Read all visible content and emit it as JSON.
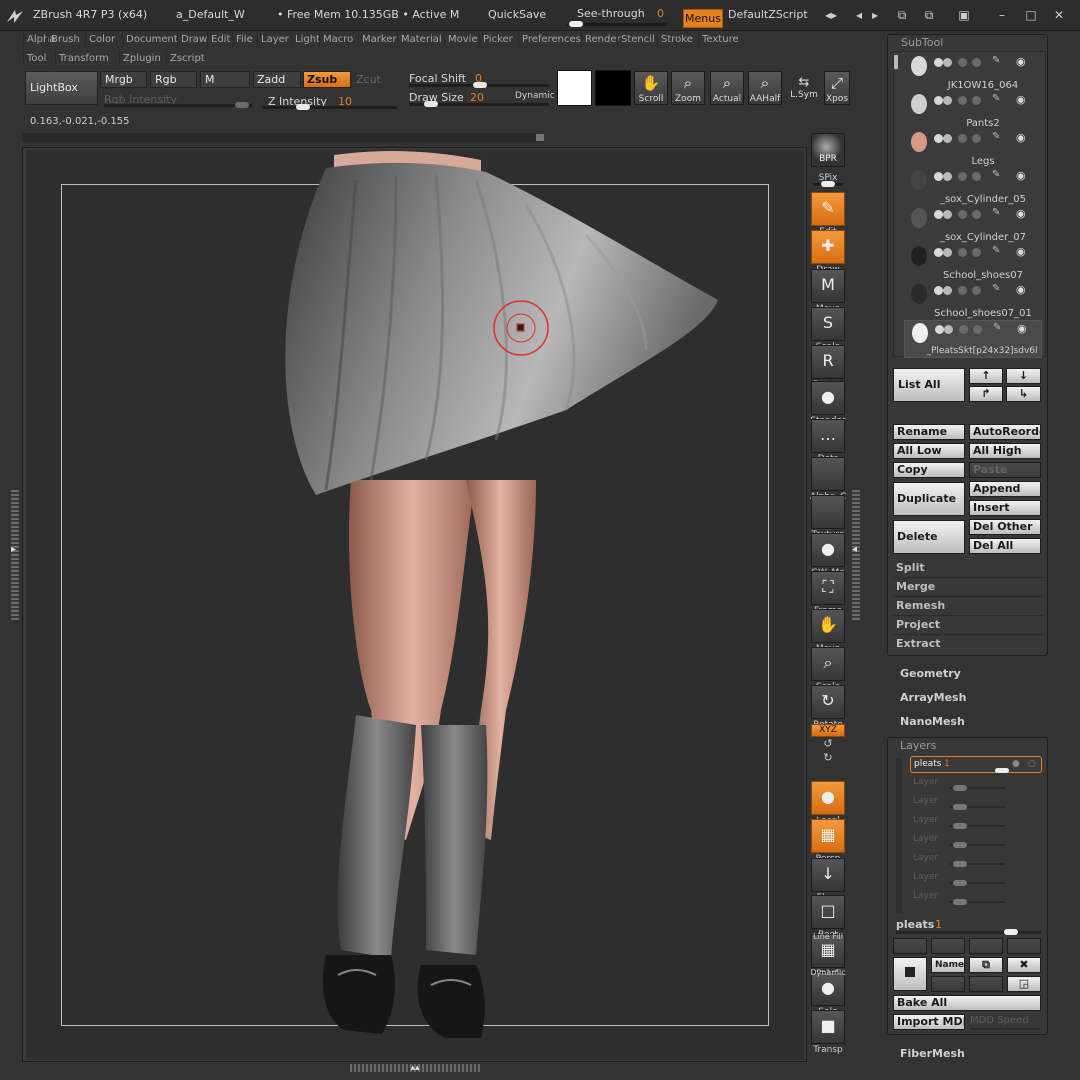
{
  "titlebar": {
    "app_title": "ZBrush 4R7 P3 (x64)",
    "doc_name": "a_Default_W",
    "free_mem": "• Free Mem 10.135GB • Active M",
    "quicksave": "QuickSave",
    "see_through": "See-through",
    "see_through_value": "0",
    "menus": "Menus",
    "default_zscript": "DefaultZScript"
  },
  "menu_row1": [
    "Alpha",
    "Brush",
    "Color",
    "Document",
    "Draw",
    "Edit",
    "File",
    "Layer",
    "Light",
    "Macro",
    "Marker",
    "Material",
    "Movie",
    "Picker",
    "Preferences",
    "Render",
    "Stencil",
    "Stroke",
    "Texture"
  ],
  "menu_row2": [
    "Tool",
    "Transform",
    "Zplugin",
    "Zscript"
  ],
  "shelf": {
    "lightbox": "LightBox",
    "mrgb": "Mrgb",
    "rgb": "Rgb",
    "m": "M",
    "zadd": "Zadd",
    "zsub": "Zsub",
    "zcut": "Zcut",
    "rgb_intensity": "Rgb Intensity",
    "z_intensity": "Z Intensity",
    "z_intensity_value": "10",
    "focal_shift": "Focal Shift",
    "focal_shift_value": "0",
    "draw_size": "Draw Size",
    "draw_size_value": "20",
    "dynamic": "Dynamic",
    "scroll": "Scroll",
    "zoom": "Zoom",
    "actual": "Actual",
    "aahalf": "AAHalf",
    "lsym": "L.Sym",
    "xpose": "Xpos"
  },
  "coords": "0.163,-0.021,-0.155",
  "right_tools": [
    {
      "name": "bpr",
      "label": "",
      "glyph": "BPR"
    },
    {
      "name": "spix",
      "label": "SPix",
      "glyph": ""
    },
    {
      "name": "edit",
      "label": "Edit",
      "glyph": "✎"
    },
    {
      "name": "draw",
      "label": "Draw",
      "glyph": "✚"
    },
    {
      "name": "move",
      "label": "Move",
      "glyph": "M"
    },
    {
      "name": "scale",
      "label": "Scale",
      "glyph": "S"
    },
    {
      "name": "rotate",
      "label": "Rotate",
      "glyph": "R"
    },
    {
      "name": "standard",
      "label": "Standar",
      "glyph": "●"
    },
    {
      "name": "dots",
      "label": "Dots",
      "glyph": "…"
    },
    {
      "name": "alpha",
      "label": "Alpha_C",
      "glyph": ""
    },
    {
      "name": "texture",
      "label": "Texture",
      "glyph": ""
    },
    {
      "name": "material",
      "label": "GW_Ma",
      "glyph": "●"
    },
    {
      "name": "frame",
      "label": "Frame",
      "glyph": "⛶"
    },
    {
      "name": "move-view",
      "label": "Move",
      "glyph": "✋"
    },
    {
      "name": "scale-view",
      "label": "Scale",
      "glyph": "⌕"
    },
    {
      "name": "rotate-view",
      "label": "Rotate",
      "glyph": "↻"
    },
    {
      "name": "xyz",
      "label": "XYZ",
      "glyph": ""
    },
    {
      "name": "local",
      "label": "Local",
      "glyph": "●"
    },
    {
      "name": "persp",
      "label": "Persp",
      "glyph": "▦"
    },
    {
      "name": "floor",
      "label": "Floor",
      "glyph": "↓"
    },
    {
      "name": "rect",
      "label": "Rect",
      "glyph": "□"
    },
    {
      "name": "polyf",
      "label": "PolyF",
      "glyph": "▦"
    },
    {
      "name": "solo",
      "label": "Solo",
      "glyph": "●"
    },
    {
      "name": "transp",
      "label": "Transp",
      "glyph": "■"
    }
  ],
  "right_tool_small": {
    "line_fill": "Line Fill",
    "dynamic": "Dynamic"
  },
  "subtool": {
    "title": "SubTool",
    "items": [
      {
        "name": "JK1OW16_064"
      },
      {
        "name": "Pants2"
      },
      {
        "name": "Legs"
      },
      {
        "name": "_sox_Cylinder_05"
      },
      {
        "name": "_sox_Cylinder_07"
      },
      {
        "name": "School_shoes07"
      },
      {
        "name": "School_shoes07_01"
      },
      {
        "name": "_PleatsSkt[p24x32]sdv6l"
      }
    ],
    "list_all": "List All",
    "rename": "Rename",
    "autoreorder": "AutoReorde",
    "all_low": "All Low",
    "all_high": "All High",
    "copy": "Copy",
    "paste": "Paste",
    "duplicate": "Duplicate",
    "append": "Append",
    "insert": "Insert",
    "delete": "Delete",
    "del_other": "Del Other",
    "del_all": "Del All",
    "split": "Split",
    "merge": "Merge",
    "remesh": "Remesh",
    "project": "Project",
    "extract": "Extract"
  },
  "sections": {
    "geometry": "Geometry",
    "arraymesh": "ArrayMesh",
    "nanomesh": "NanoMesh",
    "fibermesh": "FiberMesh"
  },
  "layers": {
    "title": "Layers",
    "active_layer": "pleats",
    "active_layer_value": "1",
    "placeholder": "Layer",
    "current_label": "pleats",
    "current_value": "1",
    "name_btn": "Name",
    "bake_all": "Bake All",
    "import_mdd": "Import MDD",
    "mdd_speed": "MDD Speed"
  },
  "colors": {
    "accent": "#e8801c",
    "panel": "#383838",
    "background": "#333333"
  }
}
